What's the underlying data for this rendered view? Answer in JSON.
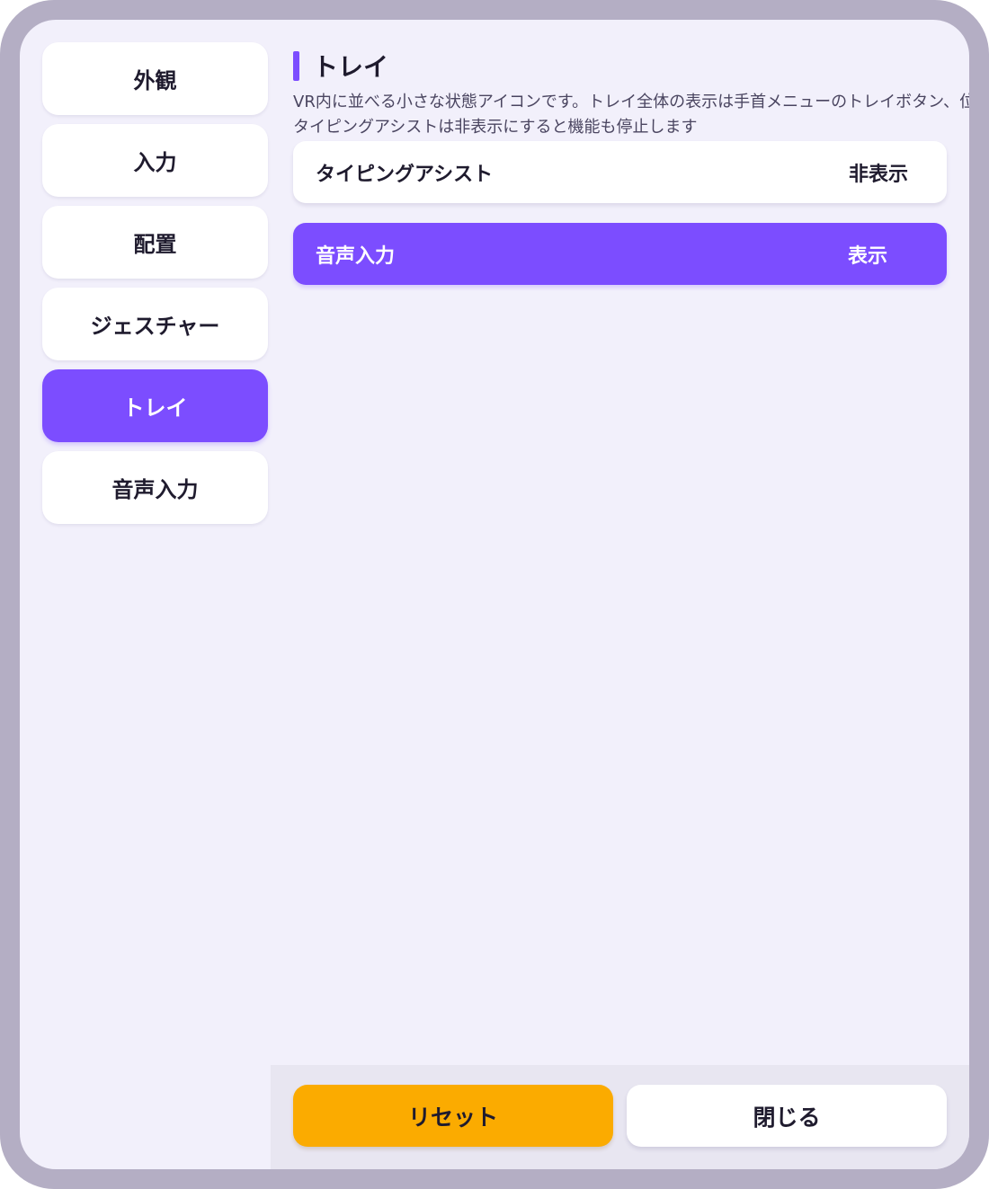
{
  "sidebar": {
    "items": [
      {
        "label": "外観"
      },
      {
        "label": "入力"
      },
      {
        "label": "配置"
      },
      {
        "label": "ジェスチャー"
      },
      {
        "label": "トレイ",
        "active": true
      },
      {
        "label": "音声入力"
      }
    ]
  },
  "section": {
    "title": "トレイ",
    "description_line1": "VR内に並べる小さな状態アイコンです。トレイ全体の表示は手首メニューのトレイボタン、位置と",
    "description_line2": "タイピングアシストは非表示にすると機能も停止します"
  },
  "settings": [
    {
      "label": "タイピングアシスト",
      "value": "非表示",
      "enabled": false
    },
    {
      "label": "音声入力",
      "value": "表示",
      "enabled": true
    }
  ],
  "footer": {
    "reset_label": "リセット",
    "close_label": "閉じる"
  },
  "colors": {
    "accent": "#7c4dff",
    "reset": "#fbab00",
    "frame": "#b4aec4",
    "panel": "#f2f0fb"
  }
}
